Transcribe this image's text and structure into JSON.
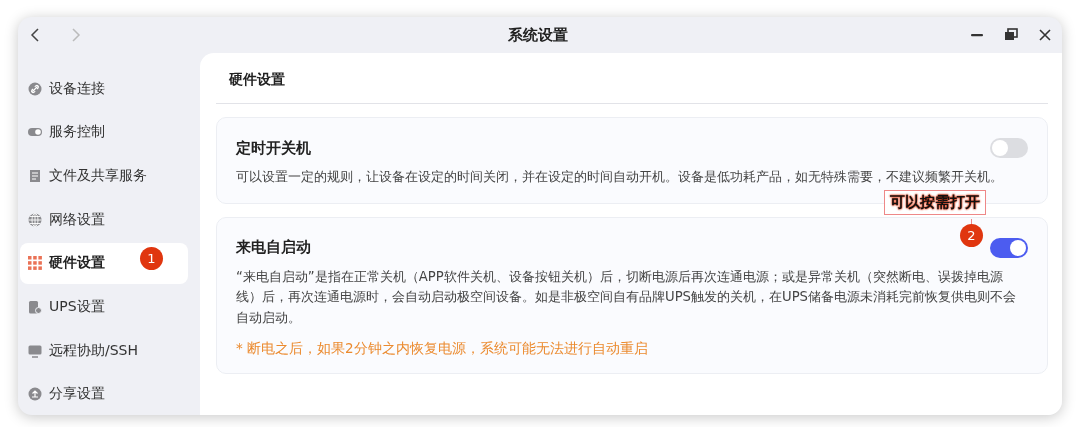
{
  "window": {
    "title": "系统设置",
    "back": {
      "disabled": false
    },
    "forward": {
      "disabled": true
    }
  },
  "sidebar": {
    "items": [
      {
        "label": "设备连接",
        "selected": false
      },
      {
        "label": "服务控制",
        "selected": false
      },
      {
        "label": "文件及共享服务",
        "selected": false
      },
      {
        "label": "网络设置",
        "selected": false
      },
      {
        "label": "硬件设置",
        "selected": true,
        "badge": "1"
      },
      {
        "label": "UPS设置",
        "selected": false
      },
      {
        "label": "远程协助/SSH",
        "selected": false
      },
      {
        "label": "分享设置",
        "selected": false
      }
    ]
  },
  "content": {
    "heading": "硬件设置",
    "cards": [
      {
        "title": "定时开关机",
        "on": false,
        "description": "可以设置一定的规则，让设备在设定的时间关闭，并在设定的时间自动开机。设备是低功耗产品，如无特殊需要，不建议频繁开关机。"
      },
      {
        "title": "来电自启动",
        "on": true,
        "description": "“来电自启动”是指在正常关机（APP软件关机、设备按钮关机）后，切断电源后再次连通电源；或是异常关机（突然断电、误拨掉电源线）后，再次连通电源时，会自动启动极空间设备。如是非极空间自有品牌UPS触发的关机，在UPS储备电源未消耗完前恢复供电则不会自动启动。",
        "note": "* 断电之后，如果2分钟之内恢复电源，系统可能无法进行自动重启",
        "callout": {
          "label": "可以按需打开",
          "badge": "2"
        }
      }
    ]
  }
}
